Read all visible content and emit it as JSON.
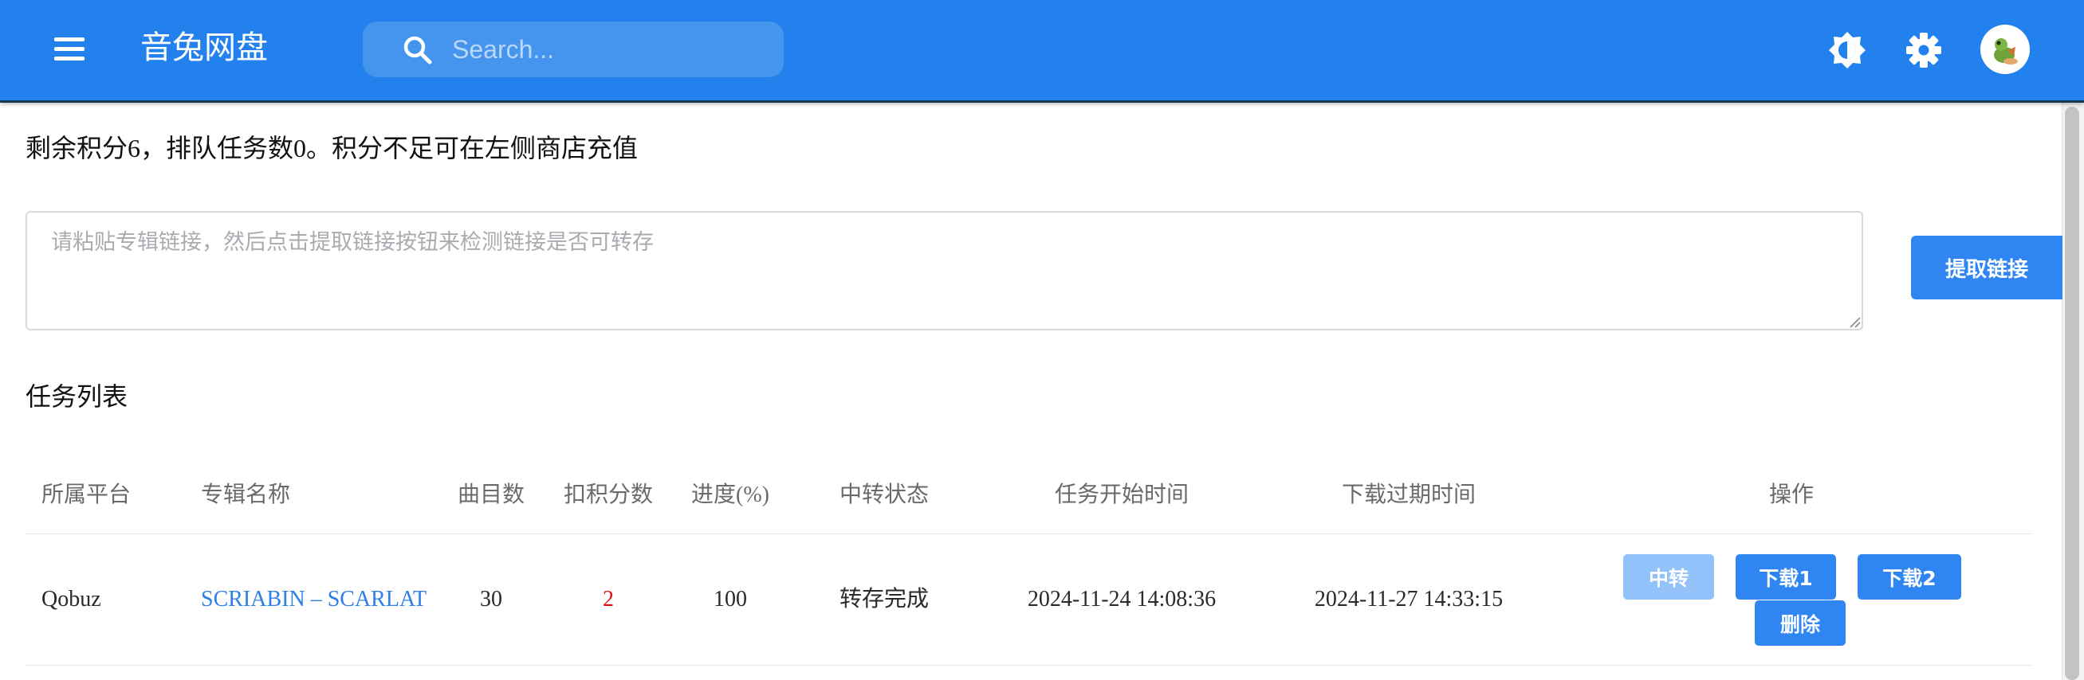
{
  "app": {
    "title": "音兔网盘"
  },
  "header": {
    "search_placeholder": "Search...",
    "icons": [
      "menu-icon",
      "search-icon",
      "theme-toggle-icon",
      "gear-icon",
      "avatar"
    ],
    "colors": {
      "appbar": "#2281ec",
      "primary_button": "#2f86f2",
      "link": "#2f7fe8",
      "credits": "#e01010"
    }
  },
  "main": {
    "credits_info": "剩余积分6，排队任务数0。积分不足可在左侧商店充值",
    "link_input": {
      "placeholder": "请粘贴专辑链接，然后点击提取链接按钮来检测链接是否可转存",
      "value": ""
    },
    "extract_button": "提取链接",
    "task_list_title": "任务列表"
  },
  "table": {
    "columns": [
      "所属平台",
      "专辑名称",
      "曲目数",
      "扣积分数",
      "进度(%)",
      "中转状态",
      "任务开始时间",
      "下载过期时间",
      "操作"
    ],
    "rows": [
      {
        "platform": "Qobuz",
        "album": "SCRIABIN – SCARLAT",
        "tracks": "30",
        "credits": "2",
        "progress": "100",
        "status": "转存完成",
        "start_time": "2024-11-24 14:08:36",
        "expire_time": "2024-11-27 14:33:15",
        "actions": {
          "transfer": "中转",
          "download1": "下载1",
          "download2": "下载2",
          "delete": "删除"
        }
      }
    ]
  }
}
